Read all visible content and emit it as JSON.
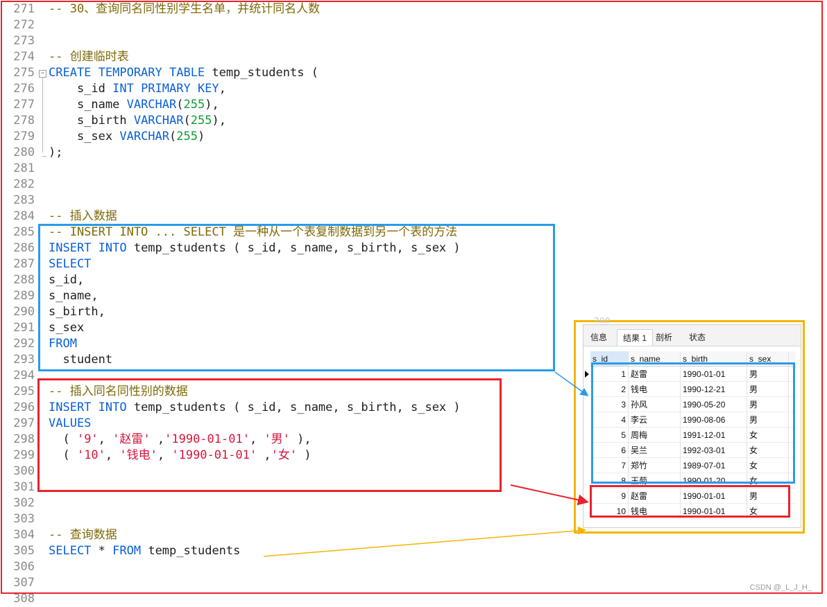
{
  "editor": {
    "lines": [
      {
        "n": "271",
        "segs": [
          {
            "t": "-- 30、查询同名同性别学生名单，并统计同名人数",
            "c": "cmt"
          }
        ]
      },
      {
        "n": "272",
        "segs": []
      },
      {
        "n": "273",
        "segs": []
      },
      {
        "n": "274",
        "segs": [
          {
            "t": "-- 创建临时表",
            "c": "cmt"
          }
        ]
      },
      {
        "n": "275",
        "fold": "−",
        "segs": [
          {
            "t": "CREATE TEMPORARY TABLE",
            "c": "kw"
          },
          {
            "t": " temp_students (",
            "c": ""
          }
        ]
      },
      {
        "n": "276",
        "segs": [
          {
            "t": "    s_id ",
            "c": ""
          },
          {
            "t": "INT PRIMARY KEY",
            "c": "kw"
          },
          {
            "t": ",",
            "c": ""
          }
        ]
      },
      {
        "n": "277",
        "segs": [
          {
            "t": "    s_name ",
            "c": ""
          },
          {
            "t": "VARCHAR",
            "c": "kw"
          },
          {
            "t": "(",
            "c": ""
          },
          {
            "t": "255",
            "c": "num"
          },
          {
            "t": "),",
            "c": ""
          }
        ]
      },
      {
        "n": "278",
        "segs": [
          {
            "t": "    s_birth ",
            "c": ""
          },
          {
            "t": "VARCHAR",
            "c": "kw"
          },
          {
            "t": "(",
            "c": ""
          },
          {
            "t": "255",
            "c": "num"
          },
          {
            "t": "),",
            "c": ""
          }
        ]
      },
      {
        "n": "279",
        "segs": [
          {
            "t": "    s_sex ",
            "c": ""
          },
          {
            "t": "VARCHAR",
            "c": "kw"
          },
          {
            "t": "(",
            "c": ""
          },
          {
            "t": "255",
            "c": "num"
          },
          {
            "t": ")",
            "c": ""
          }
        ]
      },
      {
        "n": "280",
        "segs": [
          {
            "t": ");",
            "c": ""
          }
        ]
      },
      {
        "n": "281",
        "segs": []
      },
      {
        "n": "282",
        "segs": []
      },
      {
        "n": "283",
        "segs": []
      },
      {
        "n": "284",
        "segs": [
          {
            "t": "-- 插入数据",
            "c": "cmt"
          }
        ]
      },
      {
        "n": "285",
        "segs": [
          {
            "t": "-- INSERT INTO ... SELECT 是一种从一个表复制数据到另一个表的方法",
            "c": "cmt"
          }
        ]
      },
      {
        "n": "286",
        "segs": [
          {
            "t": "INSERT INTO",
            "c": "kw"
          },
          {
            "t": " temp_students ( s_id, s_name, s_birth, s_sex )",
            "c": ""
          }
        ]
      },
      {
        "n": "287",
        "segs": [
          {
            "t": "SELECT",
            "c": "kw"
          }
        ]
      },
      {
        "n": "288",
        "segs": [
          {
            "t": "s_id,",
            "c": ""
          }
        ]
      },
      {
        "n": "289",
        "segs": [
          {
            "t": "s_name,",
            "c": ""
          }
        ]
      },
      {
        "n": "290",
        "segs": [
          {
            "t": "s_birth,",
            "c": ""
          }
        ]
      },
      {
        "n": "291",
        "segs": [
          {
            "t": "s_sex",
            "c": ""
          }
        ]
      },
      {
        "n": "292",
        "segs": [
          {
            "t": "FROM",
            "c": "kw"
          }
        ]
      },
      {
        "n": "293",
        "segs": [
          {
            "t": "  student",
            "c": ""
          }
        ]
      },
      {
        "n": "294",
        "segs": []
      },
      {
        "n": "295",
        "segs": [
          {
            "t": "-- 插入同名同性别的数据",
            "c": "cmt"
          }
        ]
      },
      {
        "n": "296",
        "segs": [
          {
            "t": "INSERT INTO",
            "c": "kw"
          },
          {
            "t": " temp_students ( s_id, s_name, s_birth, s_sex )",
            "c": ""
          }
        ]
      },
      {
        "n": "297",
        "segs": [
          {
            "t": "VALUES",
            "c": "kw"
          }
        ]
      },
      {
        "n": "298",
        "segs": [
          {
            "t": "  ( ",
            "c": ""
          },
          {
            "t": "'9'",
            "c": "str"
          },
          {
            "t": ", ",
            "c": ""
          },
          {
            "t": "'赵雷'",
            "c": "str"
          },
          {
            "t": " ,",
            "c": ""
          },
          {
            "t": "'1990-01-01'",
            "c": "str"
          },
          {
            "t": ", ",
            "c": ""
          },
          {
            "t": "'男'",
            "c": "str"
          },
          {
            "t": " ),",
            "c": ""
          }
        ]
      },
      {
        "n": "299",
        "segs": [
          {
            "t": "  ( ",
            "c": ""
          },
          {
            "t": "'10'",
            "c": "str"
          },
          {
            "t": ", ",
            "c": ""
          },
          {
            "t": "'钱电'",
            "c": "str"
          },
          {
            "t": ", ",
            "c": ""
          },
          {
            "t": "'1990-01-01'",
            "c": "str"
          },
          {
            "t": " ,",
            "c": ""
          },
          {
            "t": "'女'",
            "c": "str"
          },
          {
            "t": " )",
            "c": ""
          }
        ]
      },
      {
        "n": "300",
        "segs": []
      },
      {
        "n": "301",
        "segs": []
      },
      {
        "n": "302",
        "segs": []
      },
      {
        "n": "303",
        "segs": []
      },
      {
        "n": "304",
        "segs": [
          {
            "t": "-- 查询数据",
            "c": "cmt"
          }
        ]
      },
      {
        "n": "305",
        "segs": [
          {
            "t": "SELECT",
            "c": "kw"
          },
          {
            "t": " * ",
            "c": ""
          },
          {
            "t": "FROM",
            "c": "kw"
          },
          {
            "t": " temp_students",
            "c": ""
          }
        ]
      },
      {
        "n": "306",
        "segs": []
      },
      {
        "n": "307",
        "segs": []
      },
      {
        "n": "308",
        "segs": []
      }
    ]
  },
  "result_panel": {
    "peek_line_number": "300",
    "tabs": [
      "信息",
      "结果 1",
      "剖析",
      "状态"
    ],
    "active_tab": "结果 1",
    "columns": [
      "s_id",
      "s_name",
      "s_birth",
      "s_sex"
    ],
    "rows": [
      [
        "1",
        "赵雷",
        "1990-01-01",
        "男"
      ],
      [
        "2",
        "钱电",
        "1990-12-21",
        "男"
      ],
      [
        "3",
        "孙风",
        "1990-05-20",
        "男"
      ],
      [
        "4",
        "李云",
        "1990-08-06",
        "男"
      ],
      [
        "5",
        "周梅",
        "1991-12-01",
        "女"
      ],
      [
        "6",
        "吴兰",
        "1992-03-01",
        "女"
      ],
      [
        "7",
        "郑竹",
        "1989-07-01",
        "女"
      ],
      [
        "8",
        "王菊",
        "1990-01-20",
        "女"
      ],
      [
        "9",
        "赵雷",
        "1990-01-01",
        "男"
      ],
      [
        "10",
        "钱电",
        "1990-01-01",
        "女"
      ]
    ]
  },
  "annotation_colors": {
    "outer_frame": "#e8232b",
    "select_block": "#2a9be8",
    "insert_block": "#e8232b",
    "result_frame": "#f4b400"
  },
  "watermark": "CSDN @_L_J_H_"
}
